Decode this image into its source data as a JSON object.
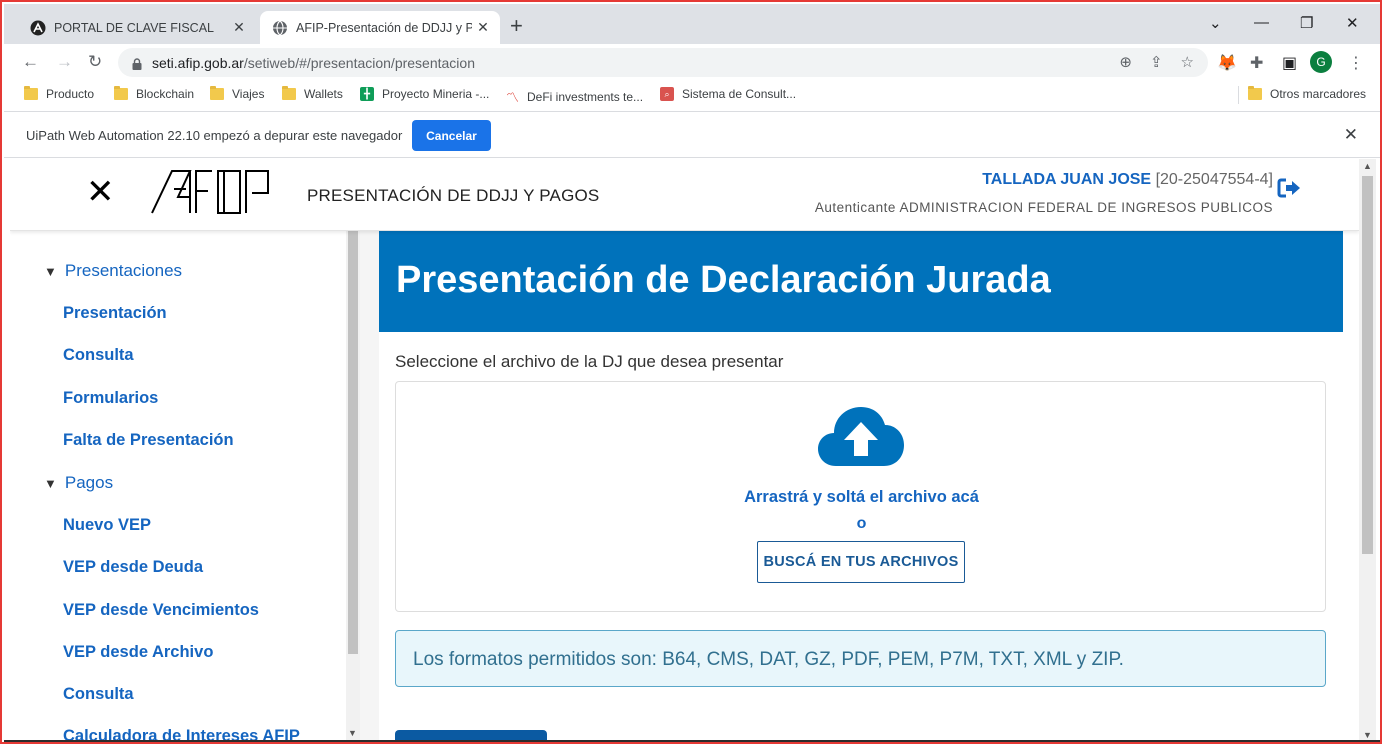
{
  "browser": {
    "tabs": [
      {
        "title": "PORTAL DE CLAVE FISCAL",
        "active": false
      },
      {
        "title": "AFIP-Presentación de DDJJ y Pag",
        "active": true
      }
    ],
    "new_tab": "+",
    "url_host": "seti.afip.gob.ar",
    "url_path": "/setiweb/#/presentacion/presentacion",
    "profile_initial": "G",
    "bookmarks": [
      "Producto",
      "Blockchain",
      "Viajes",
      "Wallets",
      "Proyecto Mineria -...",
      "DeFi investments te...",
      "Sistema de Consult..."
    ],
    "other_bookmarks": "Otros marcadores"
  },
  "infobar": {
    "message": "UiPath Web Automation 22.10 empezó a depurar este navegador",
    "cancel_label": "Cancelar"
  },
  "header": {
    "title": "PRESENTACIÓN DE DDJJ Y PAGOS",
    "user_name": "TALLADA JUAN JOSE",
    "user_cuit": "[20-25047554-4]",
    "auth_label": "Autenticante",
    "auth_org": "ADMINISTRACION FEDERAL DE INGRESOS PUBLICOS"
  },
  "sidebar": {
    "section_presentaciones": "Presentaciones",
    "items_presentaciones": [
      "Presentación",
      "Consulta",
      "Formularios",
      "Falta de Presentación"
    ],
    "section_pagos": "Pagos",
    "items_pagos": [
      "Nuevo VEP",
      "VEP desde Deuda",
      "VEP desde Vencimientos",
      "VEP desde Archivo",
      "Consulta",
      "Calculadora de Intereses AFIP"
    ]
  },
  "main": {
    "banner_title": "Presentación de Declaración Jurada",
    "subtitle": "Seleccione el archivo de la DJ que desea presentar",
    "drop_text": "Arrastrá y soltá el archivo acá",
    "drop_or": "o",
    "browse_label": "BUSCÁ EN TUS ARCHIVOS",
    "formats_text": "Los formatos permitidos son: B64, CMS, DAT, GZ, PDF, PEM, P7M, TXT, XML y ZIP."
  },
  "colors": {
    "brand_blue": "#0072bb",
    "link_blue": "#1565c0",
    "info_bg": "#e8f6fb",
    "chrome_blue_button": "#1a73e8"
  }
}
